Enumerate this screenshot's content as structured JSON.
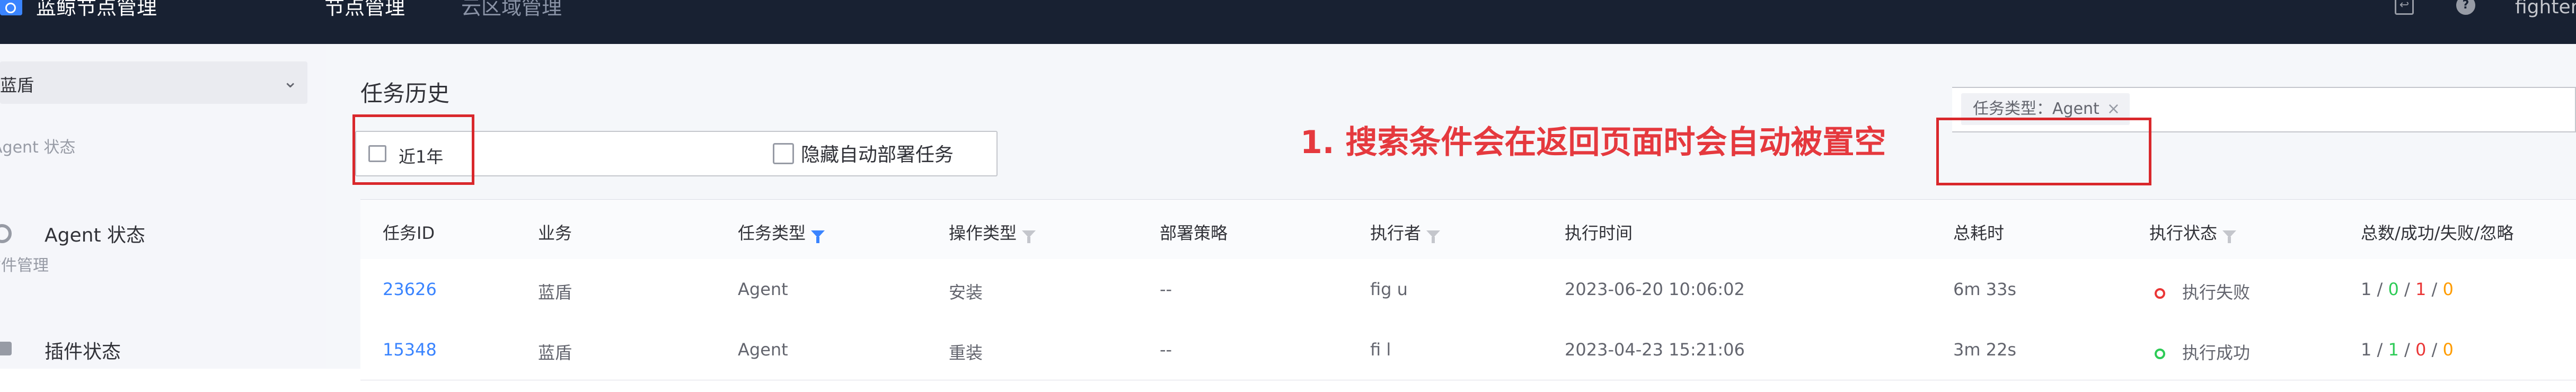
{
  "app": {
    "title": "蓝鲸节点管理",
    "user": "fighterl"
  },
  "nav": {
    "items": [
      {
        "label": "节点管理"
      },
      {
        "label": "云区域管理"
      }
    ]
  },
  "sidebar": {
    "business": "蓝盾",
    "groups": [
      {
        "title": "Agent 状态",
        "items": [
          {
            "label": "Agent 状态",
            "icon": "agent-status-icon"
          }
        ]
      },
      {
        "title": "插件管理",
        "items": [
          {
            "label": "插件状态",
            "icon": "puzzle-icon"
          }
        ]
      }
    ]
  },
  "page": {
    "title": "任务历史"
  },
  "filters": {
    "date_range": "近1年",
    "hide_auto_deploy_label": "隐藏自动部署任务",
    "hide_auto_deploy_checked": false,
    "search_tag": "任务类型：Agent"
  },
  "annotation": "1. 搜索条件会在返回页面时会自动被置空",
  "table": {
    "columns": [
      "任务ID",
      "业务",
      "任务类型",
      "操作类型",
      "部署策略",
      "执行者",
      "执行时间",
      "总耗时",
      "执行状态",
      "总数/成功/失败/忽略"
    ],
    "rows": [
      {
        "task_id": "23626",
        "business": "蓝盾",
        "task_type": "Agent",
        "op_type": "安装",
        "strategy": "--",
        "executor": "fig  u",
        "exec_time": "2023-06-20 10:06:02",
        "duration": "6m 33s",
        "status": "执行失败",
        "status_color": "#ea3636",
        "counts": {
          "total": "1",
          "success": "0",
          "failed": "1",
          "ignored": "0"
        }
      },
      {
        "task_id": "15348",
        "business": "蓝盾",
        "task_type": "Agent",
        "op_type": "重装",
        "strategy": "--",
        "executor": "fi  l",
        "exec_time": "2023-04-23 15:21:06",
        "duration": "3m 22s",
        "status": "执行成功",
        "status_color": "#2dcb56",
        "counts": {
          "total": "1",
          "success": "1",
          "failed": "0",
          "ignored": "0"
        }
      }
    ]
  },
  "colors": {
    "topbar": "#182132",
    "accent": "#3a84ff",
    "annotation_red": "#e5393e"
  }
}
